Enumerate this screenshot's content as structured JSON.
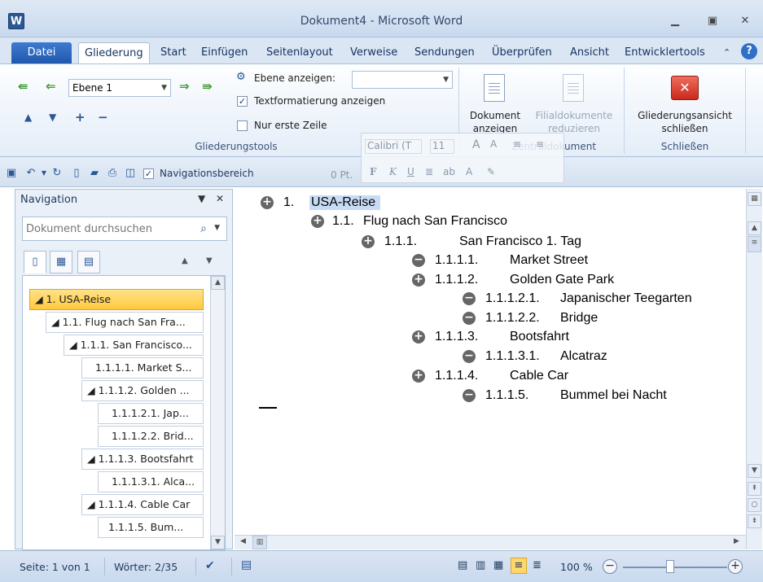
{
  "window": {
    "title": "Dokument4 - Microsoft Word",
    "app_icon": "W"
  },
  "tabs": [
    "Datei",
    "Gliederung",
    "Start",
    "Einfügen",
    "Seitenlayout",
    "Verweise",
    "Sendungen",
    "Überprüfen",
    "Ansicht",
    "Entwicklertools"
  ],
  "ribbon": {
    "level_value": "Ebene 1",
    "show_level_label": "Ebene anzeigen:",
    "show_format_label": "Textformatierung anzeigen",
    "first_line_label": "Nur erste Zeile",
    "outline_tools_label": "Gliederungstools",
    "show_doc_label1": "Dokument",
    "show_doc_label2": "anzeigen",
    "collapse_sub_label1": "Filialdokumente",
    "collapse_sub_label2": "reduzieren",
    "master_doc_label": "Zentraldokument",
    "close_label1": "Gliederungsansicht",
    "close_label2": "schließen",
    "close_group_label": "Schließen"
  },
  "mini_toolbar": {
    "font": "Calibri (T",
    "size": "11",
    "pt": "0 Pt."
  },
  "qat": {
    "nav_pane_label": "Navigationsbereich"
  },
  "navigation": {
    "title": "Navigation",
    "search_placeholder": "Dokument durchsuchen",
    "items": [
      "◢ 1. USA-Reise",
      "◢ 1.1.  Flug nach San Fra...",
      "◢ 1.1.1. San Francisco...",
      "1.1.1.1. Market S...",
      "◢ 1.1.1.2. Golden ...",
      "1.1.1.2.1. Jap...",
      "1.1.1.2.2. Brid...",
      "◢ 1.1.1.3. Bootsfahrt",
      "1.1.1.3.1. Alca...",
      "◢ 1.1.1.4. Cable Car",
      "1.1.1.5. Bum..."
    ]
  },
  "outline": [
    {
      "num": "1.",
      "text": "USA-Reise",
      "sym": "+"
    },
    {
      "num": "1.1.",
      "text": "Flug nach San Francisco",
      "sym": "+"
    },
    {
      "num": "1.1.1.",
      "text": "San Francisco 1. Tag",
      "sym": "+"
    },
    {
      "num": "1.1.1.1.",
      "text": "Market Street",
      "sym": "−"
    },
    {
      "num": "1.1.1.2.",
      "text": "Golden Gate Park",
      "sym": "+"
    },
    {
      "num": "1.1.1.2.1.",
      "text": "Japanischer Teegarten",
      "sym": "−"
    },
    {
      "num": "1.1.1.2.2.",
      "text": "Bridge",
      "sym": "−"
    },
    {
      "num": "1.1.1.3.",
      "text": "Bootsfahrt",
      "sym": "+"
    },
    {
      "num": "1.1.1.3.1.",
      "text": "Alcatraz",
      "sym": "−"
    },
    {
      "num": "1.1.1.4.",
      "text": "Cable Car",
      "sym": "+"
    },
    {
      "num": "1.1.1.5.",
      "text": "Bummel bei Nacht",
      "sym": "−"
    }
  ],
  "status": {
    "page": "Seite: 1 von 1",
    "words": "Wörter: 2/35",
    "zoom": "100 %"
  },
  "colors": {
    "accent": "#2b5797",
    "selection": "#ffc93d",
    "highlight": "#c7dcf4"
  }
}
